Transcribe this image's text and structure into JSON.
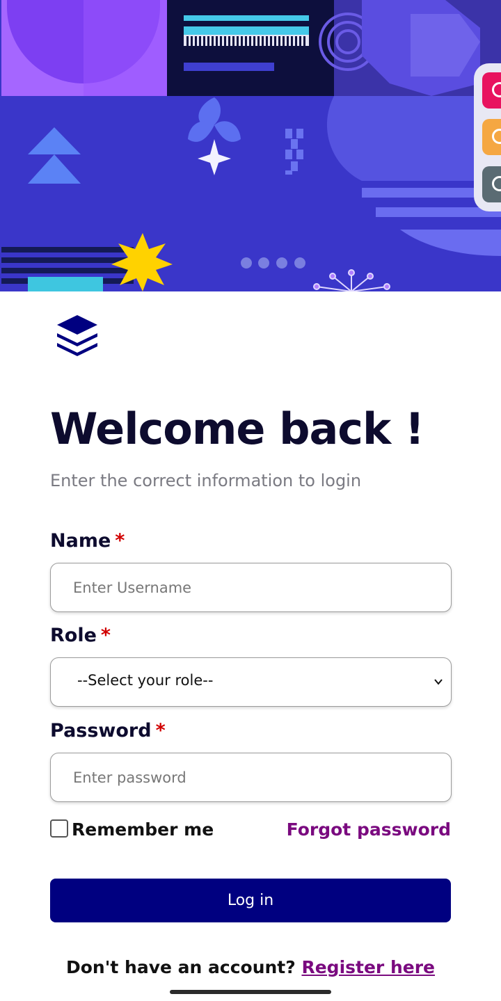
{
  "colors": {
    "primary": "#000080",
    "accent": "#7a0a7f",
    "required": "#d10000",
    "heading": "#0d0b2e",
    "hero_bg": "#3a36c9"
  },
  "hero": {
    "icon": "abstract-geometric-banner"
  },
  "side_widget": {
    "buttons": [
      {
        "icon": "plus-circle-icon",
        "color": "#e8135f"
      },
      {
        "icon": "info-icon",
        "color": "#f5a742"
      },
      {
        "icon": "chat-icon",
        "color": "#5a6b73"
      }
    ]
  },
  "logo": {
    "icon": "layers-stack-icon"
  },
  "welcome": {
    "title": "Welcome back !",
    "subtitle": "Enter the correct information to login"
  },
  "form": {
    "name": {
      "label": "Name",
      "required_mark": "*",
      "placeholder": "Enter Username",
      "value": ""
    },
    "role": {
      "label": "Role",
      "required_mark": "*",
      "selected": "--Select your role--"
    },
    "password": {
      "label": "Password",
      "required_mark": "*",
      "placeholder": "Enter password",
      "value": ""
    },
    "remember_label": "Remember me",
    "remember_checked": false,
    "forgot_label": "Forgot password",
    "submit_label": "Log in"
  },
  "footer": {
    "prompt": "Don't have an account? ",
    "link": "Register here"
  }
}
